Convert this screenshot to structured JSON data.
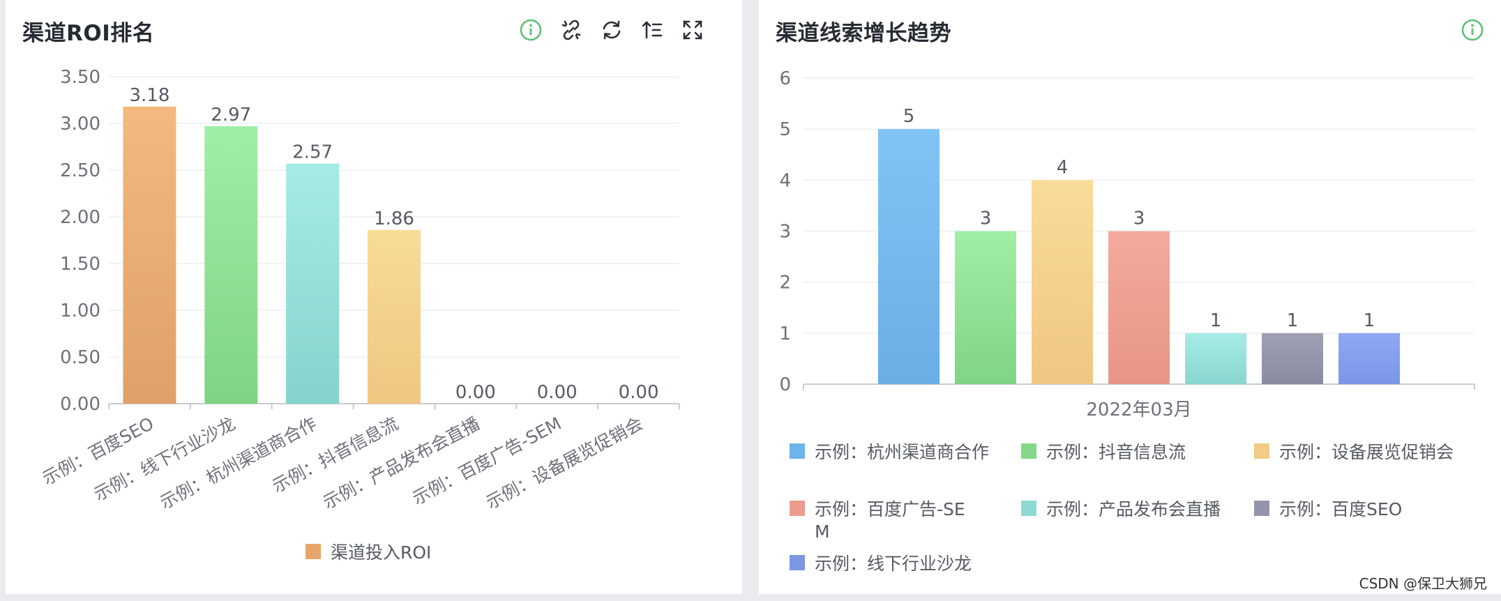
{
  "left_card": {
    "title": "渠道ROI排名",
    "toolbar_icons": [
      "info-circle-icon",
      "unlink-icon",
      "refresh-icon",
      "sort-icon",
      "fullscreen-icon"
    ]
  },
  "right_card": {
    "title": "渠道线索增长趋势",
    "toolbar_icons": [
      "info-circle-icon"
    ]
  },
  "chart_data": [
    {
      "type": "bar",
      "title": "渠道ROI排名",
      "categories": [
        "示例：百度SEO",
        "示例：线下行业沙龙",
        "示例：杭州渠道商合作",
        "示例：抖音信息流",
        "示例：产品发布会直播",
        "示例：百度广告-SEM",
        "示例：设备展览促销会"
      ],
      "series": [
        {
          "name": "渠道投入ROI",
          "values": [
            3.18,
            2.97,
            2.57,
            1.86,
            0.0,
            0.0,
            0.0
          ]
        }
      ],
      "value_labels": [
        "3.18",
        "2.97",
        "2.57",
        "1.86",
        "0.00",
        "0.00",
        "0.00"
      ],
      "yticks": [
        "0.00",
        "0.50",
        "1.00",
        "1.50",
        "2.00",
        "2.50",
        "3.00",
        "3.50"
      ],
      "ylim": [
        0,
        3.5
      ],
      "grid": true,
      "legend_position": "bottom",
      "colors": {
        "bars": [
          [
            "#f3b97e",
            "#e0a06a"
          ],
          [
            "#a0efa6",
            "#7fd484"
          ],
          [
            "#a6ece6",
            "#84d3cc"
          ],
          [
            "#f8dc96",
            "#efc780"
          ]
        ],
        "legend": "#e8a56a",
        "grid": "#eeeff2",
        "axis": "#c8cbd0"
      }
    },
    {
      "type": "bar",
      "title": "渠道线索增长趋势",
      "categories": [
        "2022年03月"
      ],
      "series": [
        {
          "name": "示例：杭州渠道商合作",
          "values": [
            5
          ],
          "color": [
            "#80c4f6",
            "#6aaee6"
          ]
        },
        {
          "name": "示例：抖音信息流",
          "values": [
            3
          ],
          "color": [
            "#a0efa6",
            "#80d485"
          ]
        },
        {
          "name": "示例：设备展览促销会",
          "values": [
            4
          ],
          "color": [
            "#f9dc98",
            "#efc782"
          ]
        },
        {
          "name": "示例：百度广告-SEM",
          "values": [
            3
          ],
          "color": [
            "#f3aa9c",
            "#e89585"
          ]
        },
        {
          "name": "示例：产品发布会直播",
          "values": [
            1
          ],
          "color": [
            "#a6ece6",
            "#88d6cf"
          ]
        },
        {
          "name": "示例：百度SEO",
          "values": [
            1
          ],
          "color": [
            "#9fa0b4",
            "#8a8ba2"
          ]
        },
        {
          "name": "示例：线下行业沙龙",
          "values": [
            1
          ],
          "color": [
            "#8fa8f3",
            "#7b96e6"
          ]
        }
      ],
      "yticks": [
        "0",
        "1",
        "2",
        "3",
        "4",
        "5",
        "6"
      ],
      "ylim": [
        0,
        6
      ],
      "grid": true,
      "legend_position": "bottom",
      "legend_colors": [
        "#6eb3ea",
        "#84d889",
        "#f2cb86",
        "#ec9c8d",
        "#8ed9d2",
        "#9394ab",
        "#7c96e2"
      ]
    }
  ],
  "watermark": "CSDN @保卫大狮兄"
}
